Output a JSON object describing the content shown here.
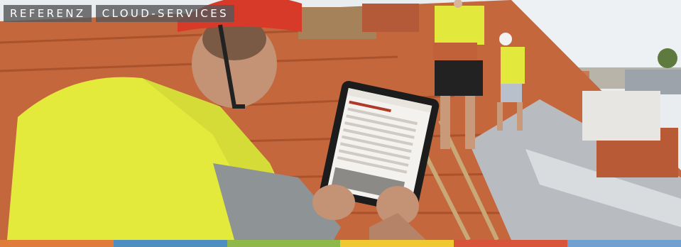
{
  "banner": {
    "tags": [
      "REFERENZ",
      "CLOUD-SERVICES"
    ],
    "stripe_colors": [
      "#e07c3a",
      "#4e8fc2",
      "#8fb84a",
      "#f0c832",
      "#d8543a",
      "#6fa0cf"
    ]
  },
  "photo": {
    "subject": "worker in yellow safety vest and red helmet using a tablet on a tiled roof",
    "colors": {
      "vest": "#e4ea3c",
      "helmet": "#d83a2a",
      "tiles": "#c2623a",
      "sky": "#e9edf0"
    }
  }
}
